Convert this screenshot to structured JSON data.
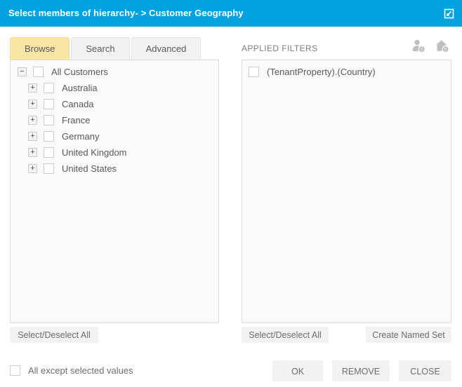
{
  "window": {
    "title": "Select members of hierarchy- > Customer Geography",
    "resize_icon": "resize-expand-icon",
    "accent_color": "#00a3e0"
  },
  "tabs": [
    {
      "label": "Browse",
      "active": true
    },
    {
      "label": "Search",
      "active": false
    },
    {
      "label": "Advanced",
      "active": false
    }
  ],
  "tree": {
    "root": {
      "label": "All Customers",
      "expander": "−",
      "checked": false
    },
    "children": [
      {
        "label": "Australia",
        "expander": "+",
        "checked": false
      },
      {
        "label": "Canada",
        "expander": "+",
        "checked": false
      },
      {
        "label": "France",
        "expander": "+",
        "checked": false
      },
      {
        "label": "Germany",
        "expander": "+",
        "checked": false
      },
      {
        "label": "United Kingdom",
        "expander": "+",
        "checked": false
      },
      {
        "label": "United States",
        "expander": "+",
        "checked": false
      }
    ]
  },
  "applied_filters": {
    "header": "APPLIED FILTERS",
    "icons": [
      {
        "name": "user-filter-icon",
        "badge": "0"
      },
      {
        "name": "home-filter-icon",
        "badge": "0"
      }
    ],
    "items": [
      {
        "label": "(TenantProperty).(Country)",
        "checked": false
      }
    ]
  },
  "buttons": {
    "left_select_all": "Select/Deselect All",
    "right_select_all": "Select/Deselect All",
    "create_named_set": "Create Named Set",
    "ok": "OK",
    "remove": "REMOVE",
    "close": "CLOSE"
  },
  "options": {
    "all_except_label": "All except selected values",
    "all_except_checked": false
  }
}
